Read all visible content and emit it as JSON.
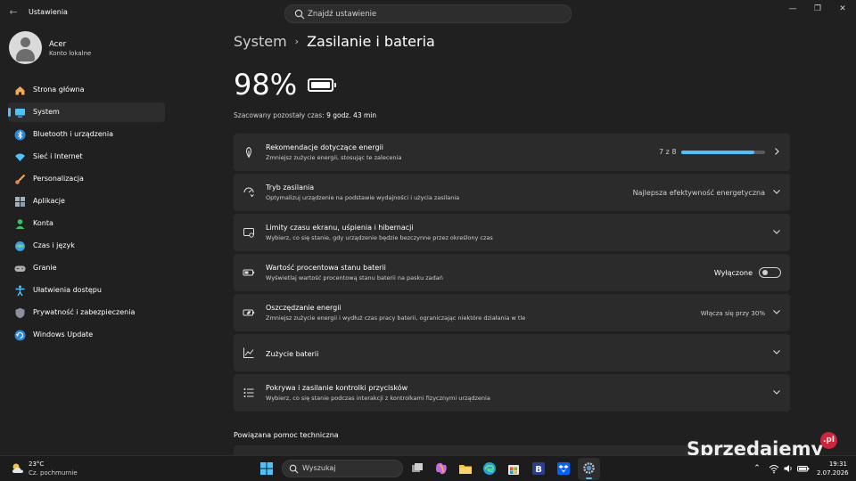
{
  "window": {
    "title": "Ustawienia",
    "search_placeholder": "Znajdź ustawienie"
  },
  "user": {
    "name": "Acer",
    "account_type": "Konto lokalne"
  },
  "sidebar": {
    "items": [
      {
        "label": "Strona główna",
        "icon": "home-icon"
      },
      {
        "label": "System",
        "icon": "system-icon",
        "active": true
      },
      {
        "label": "Bluetooth i urządzenia",
        "icon": "bluetooth-icon"
      },
      {
        "label": "Sieć i Internet",
        "icon": "wifi-icon"
      },
      {
        "label": "Personalizacja",
        "icon": "brush-icon"
      },
      {
        "label": "Aplikacje",
        "icon": "apps-icon"
      },
      {
        "label": "Konta",
        "icon": "account-icon"
      },
      {
        "label": "Czas i język",
        "icon": "globe-clock-icon"
      },
      {
        "label": "Granie",
        "icon": "gamepad-icon"
      },
      {
        "label": "Ułatwienia dostępu",
        "icon": "accessibility-icon"
      },
      {
        "label": "Prywatność i zabezpieczenia",
        "icon": "shield-icon"
      },
      {
        "label": "Windows Update",
        "icon": "update-icon"
      }
    ]
  },
  "breadcrumb": {
    "parent": "System",
    "separator": "›",
    "current": "Zasilanie i bateria"
  },
  "battery": {
    "percent_text": "98%",
    "level": 0.98,
    "remaining_label": "Szacowany pozostały czas:",
    "remaining_value": "9 godz. 43 min"
  },
  "cards": {
    "recommendations": {
      "title": "Rekomendacje dotyczące energii",
      "subtitle": "Zmniejsz zużycie energii, stosując te zalecenia",
      "count": "7 z 8",
      "progress": 0.875
    },
    "power_mode": {
      "title": "Tryb zasilania",
      "subtitle": "Optymalizuj urządzenie na podstawie wydajności i użycia zasilania",
      "value": "Najlepsza efektywność energetyczna"
    },
    "screen_sleep": {
      "title": "Limity czasu ekranu, uśpienia i hibernacji",
      "subtitle": "Wybierz, co się stanie, gdy urządzenie będzie bezczynne przez określony czas"
    },
    "battery_percentage": {
      "title": "Wartość procentowa stanu baterii",
      "subtitle": "Wyświetlaj wartość procentową stanu baterii na pasku zadań",
      "toggle_label": "Wyłączone",
      "toggle_on": false
    },
    "energy_saver": {
      "title": "Oszczędzanie energii",
      "subtitle": "Zmniejsz zużycie energii i wydłuż czas pracy baterii, ograniczając niektóre działania w tle",
      "value": "Włącza się przy 30%"
    },
    "battery_usage": {
      "title": "Zużycie baterii"
    },
    "lid_buttons": {
      "title": "Pokrywa i zasilanie kontrolki przycisków",
      "subtitle": "Wybierz, co się stanie podczas interakcji z kontrolkami fizycznymi urządzenia"
    }
  },
  "related": {
    "heading": "Powiązana pomoc techniczna"
  },
  "taskbar": {
    "weather_temp": "23°C",
    "weather_desc": "Cz. pochmurnie",
    "search_label": "Wyszukaj",
    "time": "19:31",
    "date": "2.07.2026"
  },
  "watermark": {
    "text": "Sprzedajemy",
    "suffix": ".pl"
  },
  "colors": {
    "accent": "#4cc2ff",
    "background": "#202020",
    "card": "#2b2b2b"
  }
}
